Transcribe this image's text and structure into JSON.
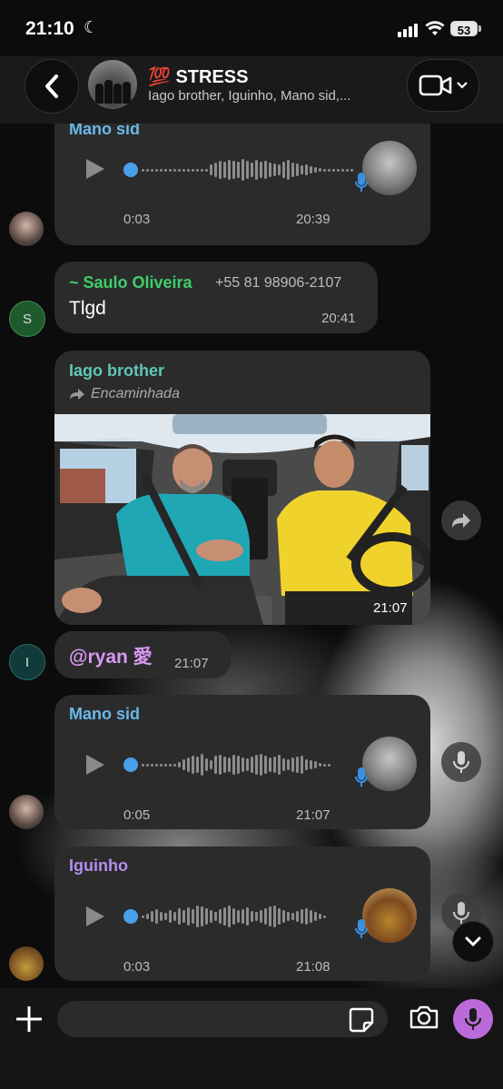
{
  "status_bar": {
    "time": "21:10",
    "battery": "53"
  },
  "header": {
    "group_emoji": "💯",
    "group_name": "STRESS",
    "members": "Iago brother, Iguinho, Mano sid,..."
  },
  "messages": [
    {
      "type": "voice",
      "sender": "Mano sid",
      "duration": "0:03",
      "time": "20:39"
    },
    {
      "type": "text",
      "sender": "~ Saulo Oliveira",
      "phone": "+55 81 98906-2107",
      "text": "Tlgd",
      "time": "20:41",
      "avatar_letter": "S"
    },
    {
      "type": "photo",
      "sender": "Iago brother",
      "forwarded_label": "Encaminhada",
      "time": "21:07"
    },
    {
      "type": "mention",
      "text": "@ryan 愛",
      "time": "21:07",
      "avatar_letter": "I"
    },
    {
      "type": "voice",
      "sender": "Mano sid",
      "duration": "0:05",
      "time": "21:07"
    },
    {
      "type": "voice",
      "sender": "Iguinho",
      "duration": "0:03",
      "time": "21:08"
    }
  ],
  "colors": {
    "mano_sid": "#6ab7e8",
    "saulo": "#3fcf6b",
    "iago": "#5fc7b5",
    "iguinho": "#b68cf0",
    "mention": "#d899f0",
    "accent": "#bb6bd9",
    "bubble": "#2b2b2b"
  },
  "icons": [
    "chevron-left-icon",
    "video-camera-icon",
    "chevron-down-icon",
    "play-icon",
    "mic-icon",
    "forward-arrow-icon",
    "plus-icon",
    "sticker-icon",
    "camera-icon"
  ]
}
